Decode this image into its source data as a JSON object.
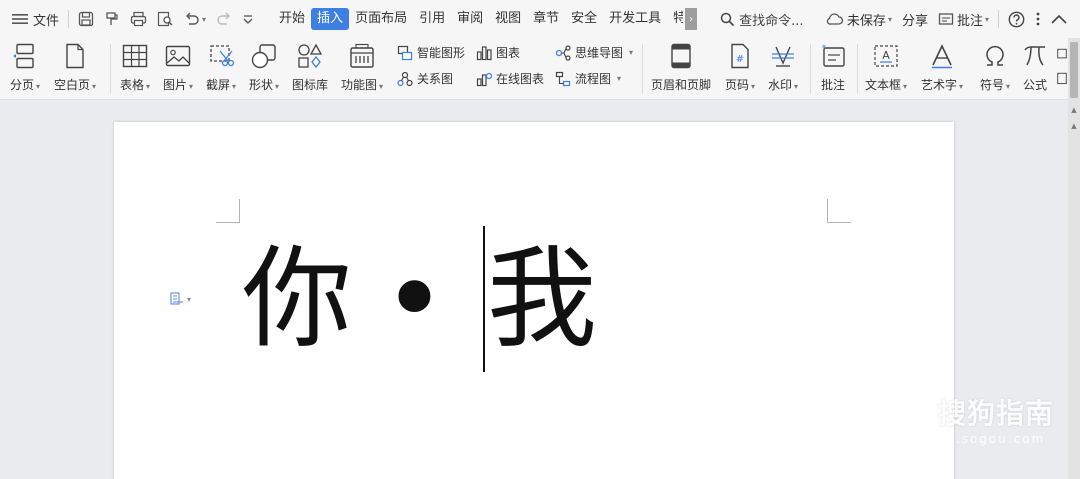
{
  "menubar": {
    "file_label": "文件",
    "tabs": [
      {
        "label": "开始",
        "active": false
      },
      {
        "label": "插入",
        "active": true
      },
      {
        "label": "页面布局",
        "active": false
      },
      {
        "label": "引用",
        "active": false
      },
      {
        "label": "审阅",
        "active": false
      },
      {
        "label": "视图",
        "active": false
      },
      {
        "label": "章节",
        "active": false
      },
      {
        "label": "安全",
        "active": false
      },
      {
        "label": "开发工具",
        "active": false
      },
      {
        "label": "特",
        "active": false
      }
    ],
    "search_label": "查找命令...",
    "unsaved_label": "未保存",
    "share_label": "分享",
    "comment_label": "批注"
  },
  "ribbon": {
    "page_break": "分页",
    "blank_page": "空白页",
    "table": "表格",
    "picture": "图片",
    "screenshot": "截屏",
    "shape": "形状",
    "icon_lib": "图标库",
    "function_chart": "功能图",
    "smart_art": "智能图形",
    "chart": "图表",
    "mind_map": "思维导图",
    "relation_chart": "关系图",
    "online_chart": "在线图表",
    "flow_chart": "流程图",
    "header_footer": "页眉和页脚",
    "page_number": "页码",
    "watermark": "水印",
    "comment": "批注",
    "text_box": "文本框",
    "word_art": "艺术字",
    "symbol": "符号",
    "formula": "公式"
  },
  "document": {
    "char1": "你",
    "dot": "•",
    "char2": "我"
  },
  "watermark": {
    "logo_letter": "S",
    "name": "搜狗指南",
    "url": "zhinan.sogou.com"
  },
  "colors": {
    "accent": "#3d7fe3",
    "page_bg": "#ffffff",
    "canvas_bg": "#e9ebee"
  }
}
